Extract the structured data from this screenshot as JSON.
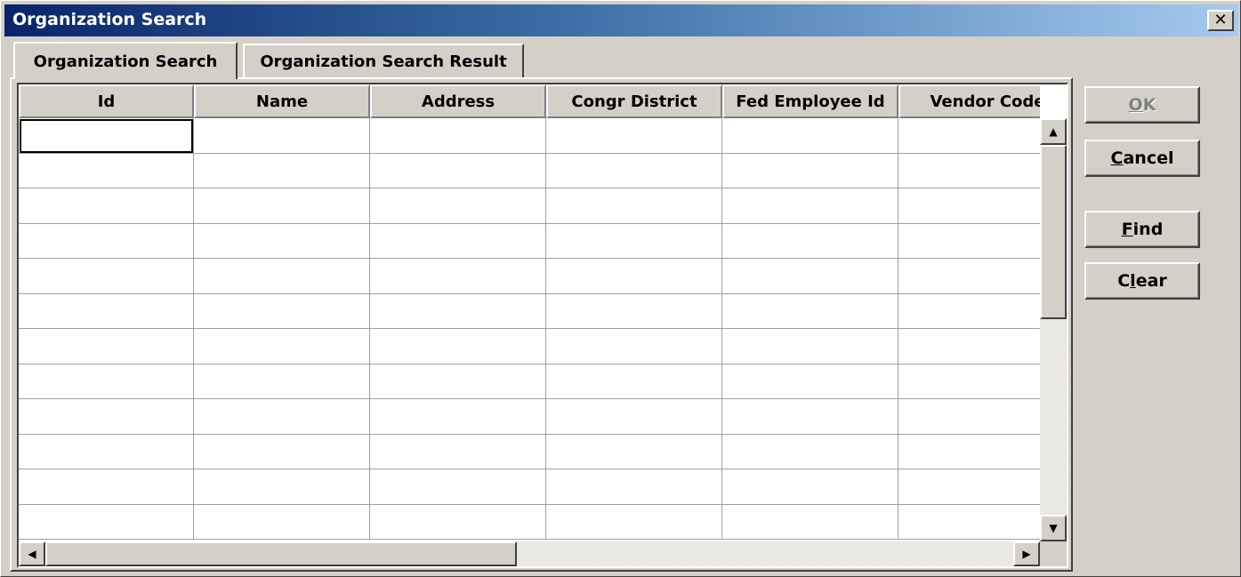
{
  "window": {
    "title": "Organization Search",
    "close_glyph": "✕"
  },
  "tabs": [
    {
      "label": "Organization Search",
      "active": true
    },
    {
      "label": "Organization Search Result",
      "active": false
    }
  ],
  "grid": {
    "columns": [
      "Id",
      "Name",
      "Address",
      "Congr District",
      "Fed Employee Id",
      "Vendor Code"
    ],
    "row_count": 12
  },
  "scrollbars": {
    "up_arrow": "▲",
    "down_arrow": "▼",
    "left_arrow": "◀",
    "right_arrow": "▶"
  },
  "buttons": {
    "ok": {
      "mnemonic": "O",
      "rest": "K",
      "enabled": false
    },
    "cancel": {
      "mnemonic": "C",
      "rest": "ancel",
      "enabled": true
    },
    "find": {
      "mnemonic": "F",
      "rest": "ind",
      "enabled": true
    },
    "clear": {
      "pre": "C",
      "mnemonic": "l",
      "rest": "ear",
      "enabled": true
    }
  },
  "colors": {
    "titlebar_start": "#0a246a",
    "titlebar_end": "#a6caf0",
    "face": "#d4d0c8"
  }
}
